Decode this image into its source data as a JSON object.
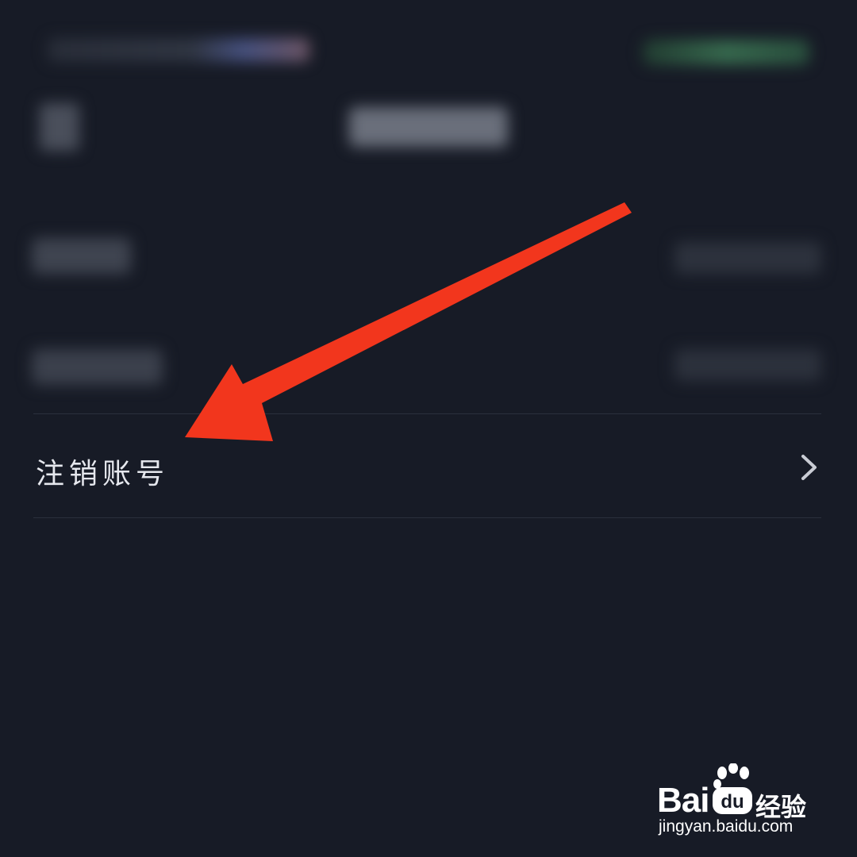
{
  "menu": {
    "deactivate_label": "注销账号"
  },
  "watermark": {
    "brand_bai": "Bai",
    "brand_du": "du",
    "brand_sub": "经验",
    "url": "jingyan.baidu.com"
  },
  "colors": {
    "background": "#171b26",
    "annotation_arrow": "#f2361d",
    "label_text": "#e6e8ee"
  },
  "icons": {
    "chevron": "chevron-right-icon",
    "arrow": "annotation-arrow"
  }
}
